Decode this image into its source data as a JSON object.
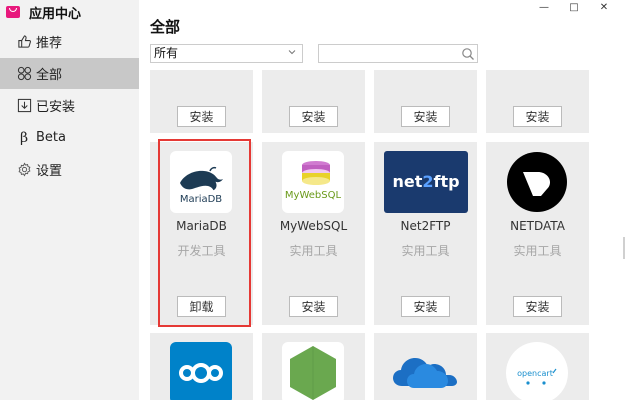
{
  "app": {
    "title": "应用中心",
    "brand_color": "#e8197d"
  },
  "sidebar": {
    "items": [
      {
        "label": "推荐",
        "icon": "thumbs-up-icon",
        "active": false
      },
      {
        "label": "全部",
        "icon": "grid-icon",
        "active": true
      },
      {
        "label": "已安装",
        "icon": "download-box-icon",
        "active": false
      },
      {
        "label": "Beta",
        "icon": "beta-icon",
        "active": false
      },
      {
        "label": "设置",
        "icon": "gear-icon",
        "active": false
      }
    ]
  },
  "window": {
    "minimize": "—",
    "maximize": "□",
    "close": "✕"
  },
  "main": {
    "title": "全部",
    "filter": {
      "selected": "所有"
    },
    "search": {
      "value": "",
      "placeholder": ""
    }
  },
  "apps": {
    "row1": [
      {
        "button": "安装"
      },
      {
        "button": "安装"
      },
      {
        "button": "安装"
      },
      {
        "button": "安装"
      }
    ],
    "row2": [
      {
        "name": "MariaDB",
        "category": "开发工具",
        "button": "卸载",
        "icon": "mariadb-icon",
        "selected": true
      },
      {
        "name": "MyWebSQL",
        "category": "实用工具",
        "button": "安装",
        "icon": "mywebsql-icon"
      },
      {
        "name": "Net2FTP",
        "category": "实用工具",
        "button": "安装",
        "icon": "net2ftp-icon"
      },
      {
        "name": "NETDATA",
        "category": "实用工具",
        "button": "安装",
        "icon": "netdata-icon"
      }
    ],
    "row3": [
      {
        "icon": "nextcloud-icon"
      },
      {
        "icon": "nodejs-icon"
      },
      {
        "icon": "onedrive-icon"
      },
      {
        "icon": "opencart-icon",
        "label": "opencart"
      }
    ]
  },
  "colors": {
    "selection": "#e53935",
    "card_bg": "#ececec",
    "sidebar_bg": "#f2f2f2",
    "active_nav": "#c8c8c8"
  }
}
